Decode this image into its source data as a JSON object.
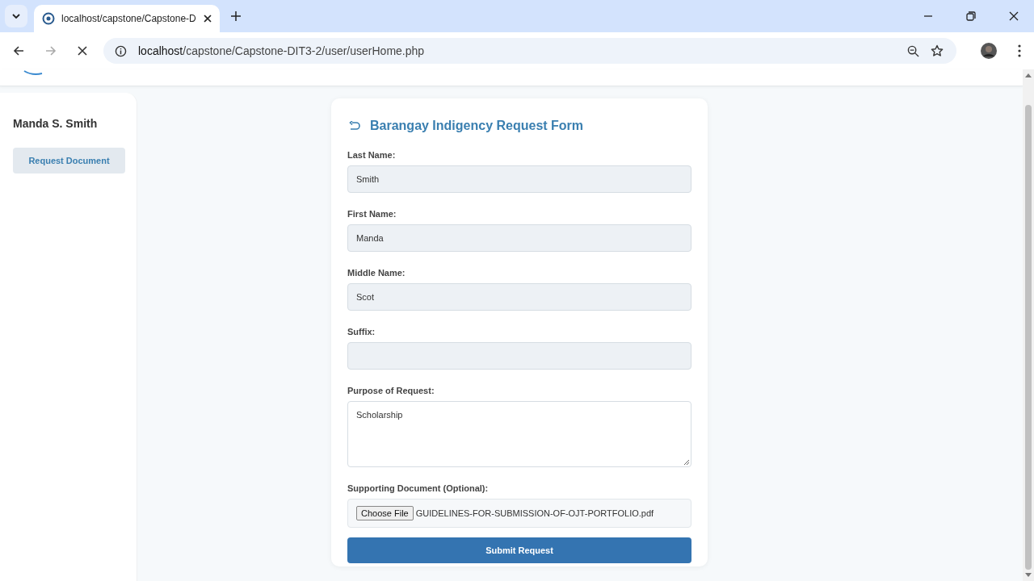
{
  "browser": {
    "tab_title": "localhost/capstone/Capstone-D",
    "url_host": "localhost",
    "url_path": "/capstone/Capstone-DIT3-2/user/userHome.php"
  },
  "sidebar": {
    "user_name": "Manda S. Smith",
    "items": [
      {
        "label": "Request Document",
        "selected": true
      }
    ]
  },
  "form": {
    "title": "Barangay Indigency Request Form",
    "fields": [
      {
        "kind": "text",
        "label": "Last Name:",
        "value": "Smith"
      },
      {
        "kind": "text",
        "label": "First Name:",
        "value": "Manda"
      },
      {
        "kind": "text",
        "label": "Middle Name:",
        "value": "Scot"
      },
      {
        "kind": "text",
        "label": "Suffix:"
      },
      {
        "kind": "textarea",
        "label": "Purpose of Request:",
        "value": "Scholarship"
      },
      {
        "kind": "file",
        "label": "Supporting Document (Optional):",
        "button": "Choose File",
        "value": "GUIDELINES-FOR-SUBMISSION-OF-OJT-PORTFOLIO.pdf"
      }
    ],
    "submit": "Submit Request"
  }
}
